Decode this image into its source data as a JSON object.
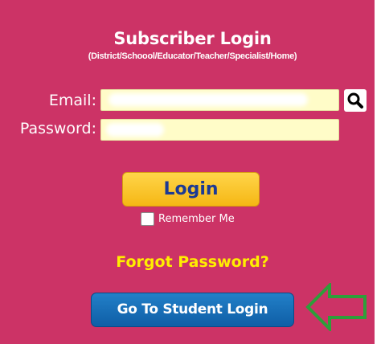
{
  "login_panel": {
    "title": "Subscriber Login",
    "subtitle": "(District/Schoool/Educator/Teacher/Specialist/Home)",
    "email_label": "Email:",
    "password_label": "Password:",
    "email_value": "",
    "password_value": "",
    "login_button": "Login",
    "remember_me_label": "Remember Me",
    "remember_me_checked": false,
    "forgot_password_link": "Forgot Password?",
    "student_login_button": "Go To Student Login",
    "search_icon": "search-icon",
    "arrow_icon": "arrow-left-outline-icon"
  },
  "colors": {
    "panel_background": "#cc3366",
    "input_background": "#fffcc8",
    "login_button": "#f5b714",
    "login_button_text": "#1c3a94",
    "forgot_password_text": "#ffee00",
    "student_button": "#1670b8",
    "arrow_outline": "#2e9e3a"
  }
}
